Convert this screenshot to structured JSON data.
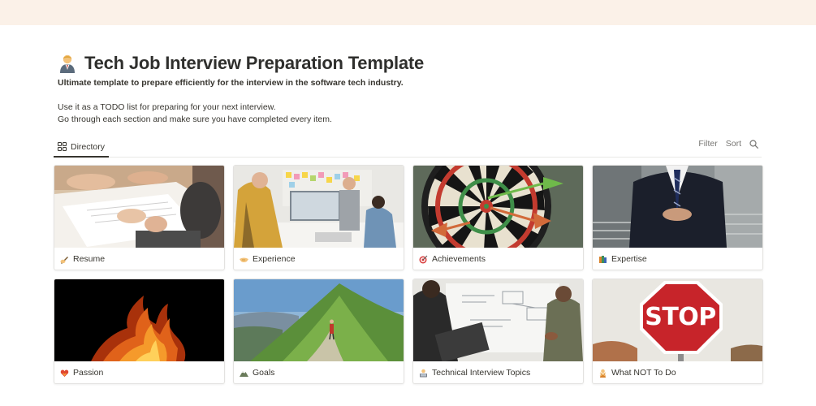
{
  "page": {
    "title": "Tech Job Interview Preparation Template",
    "title_icon": "person-in-suit-icon",
    "subtitle": "Ultimate template to prepare efficiently for the interview in the software tech industry.",
    "description": [
      "Use it as a TODO list for preparing for your next interview.",
      "Go through each section and make sure you have completed every item."
    ]
  },
  "view": {
    "tab_label": "Directory",
    "tab_icon": "gallery-grid-icon",
    "filter_label": "Filter",
    "sort_label": "Sort",
    "search_icon": "search-icon"
  },
  "cards": [
    {
      "label": "Resume",
      "icon": "writing-hand-icon",
      "image": "hands-signing-paper"
    },
    {
      "label": "Experience",
      "icon": "handshake-icon",
      "image": "office-meeting-sticky-notes"
    },
    {
      "label": "Achievements",
      "icon": "bullseye-dart-icon",
      "image": "dartboard-darts"
    },
    {
      "label": "Expertise",
      "icon": "books-icon",
      "image": "businessman-suit"
    },
    {
      "label": "Passion",
      "icon": "heart-on-fire-icon",
      "image": "fire-flames"
    },
    {
      "label": "Goals",
      "icon": "mountain-icon",
      "image": "hiker-mountain-ridge"
    },
    {
      "label": "Technical Interview Topics",
      "icon": "technologist-icon",
      "image": "whiteboard-discussion"
    },
    {
      "label": "What NOT To Do",
      "icon": "person-gesturing-no-icon",
      "image": "stop-sign"
    }
  ],
  "colors": {
    "cover": "#fbf1e8",
    "text": "#37352f",
    "muted": "#787774",
    "border": "#e3e2e0"
  }
}
